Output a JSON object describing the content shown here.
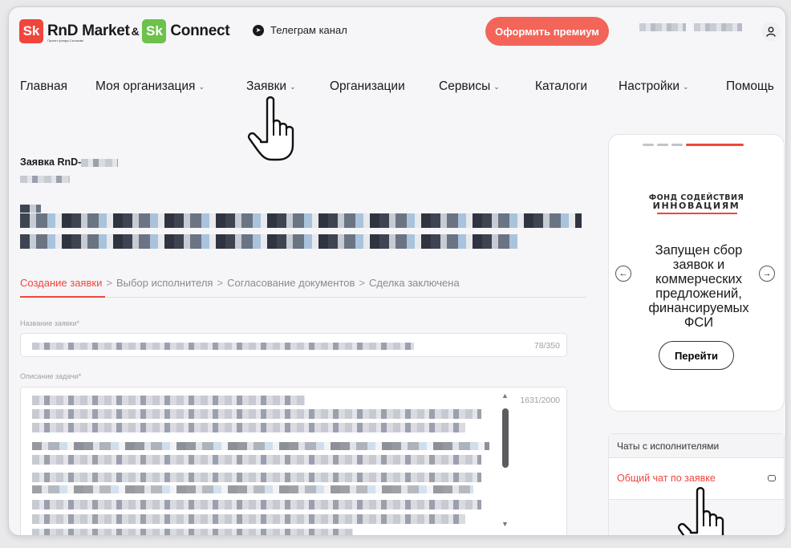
{
  "header": {
    "brand_logo_left": "Sk",
    "brand_name": "RnD Market",
    "brand_amp": "&",
    "brand_logo_right": "Sk",
    "brand_connect": "Connect",
    "brand_subtitle": "Проект фонда Сколково",
    "telegram_label": "Телеграм канал",
    "premium_label": "Оформить премиум",
    "user_icon": "user-icon"
  },
  "nav": {
    "items": [
      {
        "label": "Главная",
        "has_menu": false
      },
      {
        "label": "Моя организация",
        "has_menu": true
      },
      {
        "label": "Заявки",
        "has_menu": true
      },
      {
        "label": "Организации",
        "has_menu": false
      },
      {
        "label": "Сервисы",
        "has_menu": true
      },
      {
        "label": "Каталоги",
        "has_menu": false
      },
      {
        "label": "Настройки",
        "has_menu": true
      },
      {
        "label": "Помощь",
        "has_menu": false
      }
    ],
    "chevron": "⌄"
  },
  "request": {
    "title_prefix": "Заявка RnD-"
  },
  "steps": {
    "items": [
      "Создание заявки",
      "Выбор исполнителя",
      "Согласование документов",
      "Сделка заключена"
    ],
    "active_index": 0,
    "separator": ">"
  },
  "form": {
    "name_label": "Название заявки*",
    "name_counter": "78/350",
    "desc_label": "Описание задачи*",
    "desc_counter": "1631/2000"
  },
  "banner": {
    "fund_line1": "ФОНД СОДЕЙСТВИЯ",
    "fund_line2": "ИННОВАЦИЯМ",
    "text": "Запущен сбор заявок и коммерческих предложений, финансируемых ФСИ",
    "button_label": "Перейти",
    "prev_icon": "←",
    "next_icon": "→",
    "slides_total": 4,
    "slide_active": 4
  },
  "chats": {
    "header": "Чаты с исполнителями",
    "items": [
      "Общий чат по заявке"
    ]
  },
  "colors": {
    "accent": "#f0463c",
    "premium": "#f36459",
    "skolkovo_green": "#6cc24a"
  }
}
